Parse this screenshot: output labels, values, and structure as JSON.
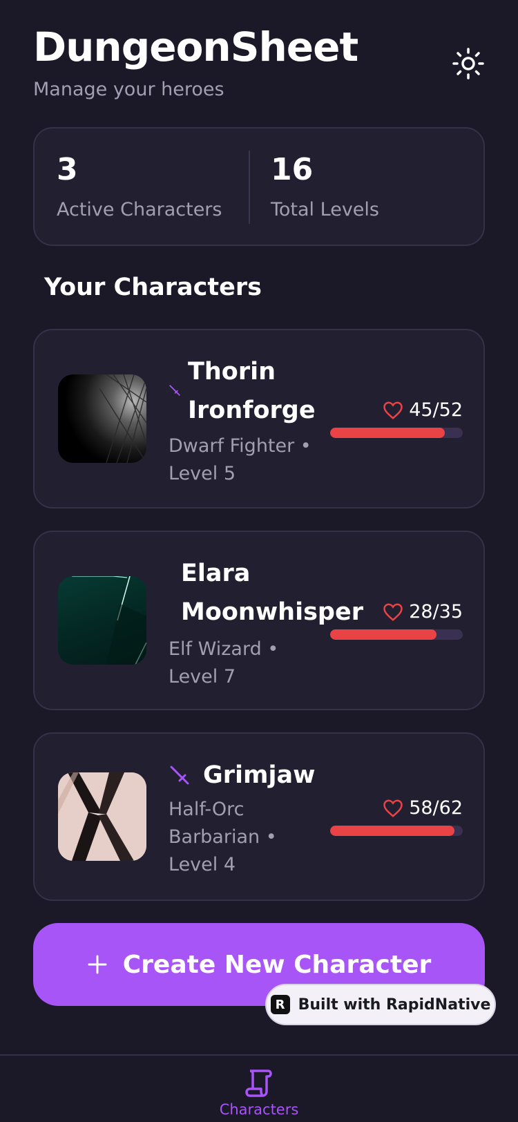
{
  "header": {
    "title": "DungeonSheet",
    "subtitle": "Manage your heroes",
    "theme_icon": "sun-icon"
  },
  "stats": {
    "active": {
      "value": "3",
      "label": "Active Characters"
    },
    "levels": {
      "value": "16",
      "label": "Total Levels"
    }
  },
  "section_title": "Your Characters",
  "characters": [
    {
      "name_line1": "Thorin",
      "name_line2": "Ironforge",
      "meta_line1": "Dwarf Fighter •",
      "meta_line2": "Level 5",
      "hp": "45/52",
      "hp_fraction": 0.865,
      "class_icon": "sword-icon"
    },
    {
      "name_line1": "Elara",
      "name_line2": "Moonwhisper",
      "meta_line1": "Elf Wizard •",
      "meta_line2": "Level 7",
      "hp": "28/35",
      "hp_fraction": 0.8
    },
    {
      "name_line1": "Grimjaw",
      "meta_line1": "Half-Orc",
      "meta_line2": "Barbarian •",
      "meta_line3": "Level 4",
      "hp": "58/62",
      "hp_fraction": 0.935,
      "class_icon": "sword-icon"
    }
  ],
  "create_button": {
    "label": "Create New Character",
    "icon": "plus-icon"
  },
  "badge": {
    "label": "Built with RapidNative",
    "logo": "R"
  },
  "nav": {
    "characters_label": "Characters",
    "icon": "scroll-icon"
  },
  "colors": {
    "background": "#1b1828",
    "card": "#221f31",
    "accent": "#a855f7",
    "hp": "#ea4346"
  }
}
